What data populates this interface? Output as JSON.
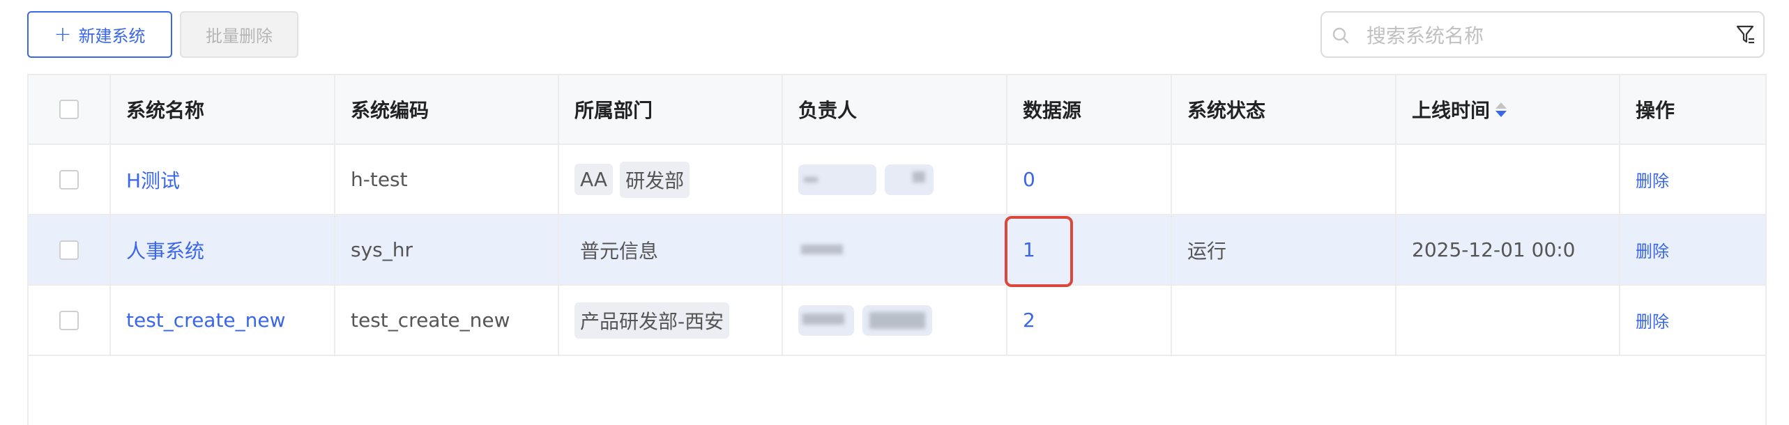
{
  "toolbar": {
    "new_label": "新建系统",
    "batch_delete_label": "批量删除",
    "search_placeholder": "搜索系统名称"
  },
  "table": {
    "headers": [
      "系统名称",
      "系统编码",
      "所属部门",
      "负责人",
      "数据源",
      "系统状态",
      "上线时间",
      "操作"
    ],
    "rows": [
      {
        "name": "H测试",
        "code": "h-test",
        "departments": [
          "AA",
          "研发部"
        ],
        "datasource": "0",
        "status": "",
        "online_time": "",
        "action": "删除"
      },
      {
        "name": "人事系统",
        "code": "sys_hr",
        "departments": [
          "普元信息"
        ],
        "datasource": "1",
        "status": "运行",
        "online_time": "2025-12-01 00:0",
        "action": "删除"
      },
      {
        "name": "test_create_new",
        "code": "test_create_new",
        "departments": [
          "产品研发部-西安"
        ],
        "datasource": "2",
        "status": "",
        "online_time": "",
        "action": "删除"
      }
    ]
  },
  "colors": {
    "accent": "#3a66e8",
    "selected_row": "#eaeffc",
    "highlight": "#d9483b"
  },
  "icons": [
    "plus-icon",
    "search-icon",
    "filter-icon",
    "sort-icon"
  ]
}
